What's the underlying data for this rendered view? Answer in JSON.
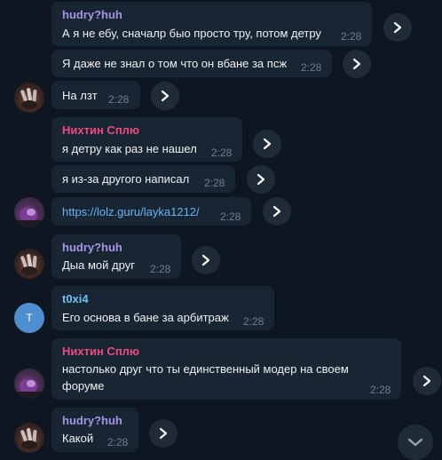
{
  "messages": [
    {
      "sender": "hudry?huh",
      "text": "А я не ебу, сначалр быо просто тру, потом детру",
      "time": "2:28"
    },
    {
      "text": "Я даже не знал о том что он вбане за псж",
      "time": "2:28"
    },
    {
      "text": "На лзт",
      "time": "2:28"
    },
    {
      "sender": "Нихтин Сплю",
      "text": "я детру как раз не нашел",
      "time": "2:28"
    },
    {
      "text": "я из-за другого написал",
      "time": "2:28"
    },
    {
      "text": "https://lolz.guru/layka1212/",
      "time": "2:28"
    },
    {
      "sender": "hudry?huh",
      "text": "Дыа мой друг",
      "time": "2:28"
    },
    {
      "sender": "t0xi4",
      "text": "Его основа в бане за арбитраж",
      "time": "2:28"
    },
    {
      "sender": "Нихтин Сплю",
      "text": "настолько друг что ты единственный модер на своем форуме",
      "time": "2:28"
    },
    {
      "sender": "hudry?huh",
      "text": "Какой",
      "time": "2:28"
    }
  ],
  "avatar_t_initial": "T",
  "icons": {
    "forward": "forward-arrow-icon",
    "scroll": "chevron-down-icon"
  },
  "colors": {
    "background": "#0e1621",
    "bubble": "#182533",
    "sender_hudry": "#a695e7",
    "sender_nihtin": "#ee4a7f",
    "sender_t0xi4": "#6ec1f5",
    "link": "#6ab3f3"
  }
}
